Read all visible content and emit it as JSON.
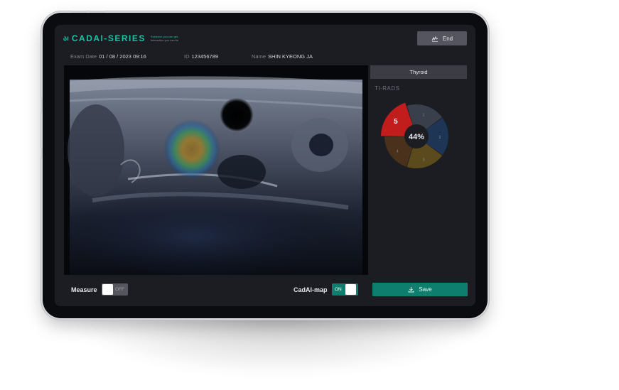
{
  "brand": {
    "mark": "აı",
    "name": "CADAI-SERIES",
    "tagline_line1": "Evidence you can get,",
    "tagline_line2": "Interaction you can be"
  },
  "header": {
    "end_label": "End",
    "end_icon": "signature-icon"
  },
  "exam": {
    "date_label": "Exam Date",
    "date_value": "01 / 08 / 2023   09:16",
    "id_label": "ID",
    "id_value": "123456789",
    "name_label": "Name",
    "name_value": "SHIN KYEONG JA"
  },
  "panel": {
    "tab_label": "Thyroid",
    "section_label": "TI-RADS",
    "probability": "44%",
    "selected_category": "5",
    "segments": [
      {
        "label": "1",
        "color": "#3a3f4c"
      },
      {
        "label": "2",
        "color": "#1e3556"
      },
      {
        "label": "3",
        "color": "#5b4a1c"
      },
      {
        "label": "4",
        "color": "#4a311c"
      },
      {
        "label": "5",
        "color": "#c11d1d"
      }
    ]
  },
  "controls": {
    "measure_label": "Measure",
    "measure_state": "OFF",
    "cadai_label": "CadAI-map",
    "cadai_state": "ON",
    "save_label": "Save",
    "save_icon": "download-icon"
  },
  "colors": {
    "accent": "#0e7f6e",
    "brand": "#19c2a5",
    "alert": "#c11d1d"
  }
}
